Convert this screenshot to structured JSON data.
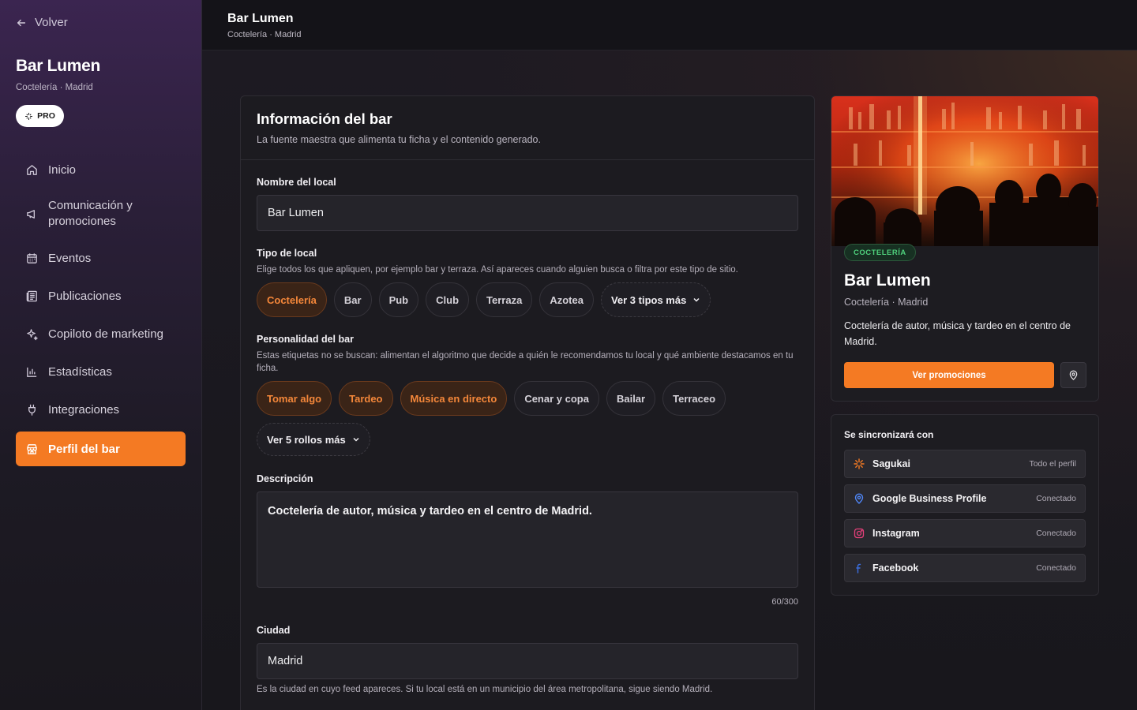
{
  "sidebar": {
    "back_label": "Volver",
    "brand_title": "Bar Lumen",
    "brand_subtitle": "Coctelería · Madrid",
    "plan_badge": "PRO",
    "items": [
      {
        "label": "Inicio",
        "icon": "home-icon"
      },
      {
        "label": "Comunicación y promociones",
        "icon": "megaphone-icon"
      },
      {
        "label": "Eventos",
        "icon": "calendar-icon"
      },
      {
        "label": "Publicaciones",
        "icon": "newspaper-icon"
      },
      {
        "label": "Copiloto de marketing",
        "icon": "sparkles-icon"
      },
      {
        "label": "Estadísticas",
        "icon": "bar-chart-icon"
      },
      {
        "label": "Integraciones",
        "icon": "plug-icon"
      },
      {
        "label": "Perfil del bar",
        "icon": "store-icon",
        "active": true
      }
    ]
  },
  "header": {
    "title": "Bar Lumen",
    "subtitle": "Coctelería · Madrid"
  },
  "form": {
    "title": "Información del bar",
    "subtitle": "La fuente maestra que alimenta tu ficha y el contenido generado.",
    "name": {
      "label": "Nombre del local",
      "value": "Bar Lumen"
    },
    "type": {
      "label": "Tipo de local",
      "help": "Elige todos los que apliquen, por ejemplo bar y terraza. Así apareces cuando alguien busca o filtra por este tipo de sitio.",
      "options": [
        {
          "label": "Coctelería",
          "selected": true
        },
        {
          "label": "Bar",
          "selected": false
        },
        {
          "label": "Pub",
          "selected": false
        },
        {
          "label": "Club",
          "selected": false
        },
        {
          "label": "Terraza",
          "selected": false
        },
        {
          "label": "Azotea",
          "selected": false
        }
      ],
      "more_label": "Ver 3 tipos más"
    },
    "personality": {
      "label": "Personalidad del bar",
      "help": "Estas etiquetas no se buscan: alimentan el algoritmo que decide a quién le recomendamos tu local y qué ambiente destacamos en tu ficha.",
      "options": [
        {
          "label": "Tomar algo",
          "selected": true
        },
        {
          "label": "Tardeo",
          "selected": true
        },
        {
          "label": "Música en directo",
          "selected": true
        },
        {
          "label": "Cenar y copa",
          "selected": false
        },
        {
          "label": "Bailar",
          "selected": false
        },
        {
          "label": "Terraceo",
          "selected": false
        }
      ],
      "more_label": "Ver 5 rollos más"
    },
    "description": {
      "label": "Descripción",
      "value": "Coctelería de autor, música y tardeo en el centro de Madrid.",
      "counter": "60/300"
    },
    "city": {
      "label": "Ciudad",
      "value": "Madrid",
      "help": "Es la ciudad en cuyo feed apareces. Si tu local está en un municipio del área metropolitana, sigue siendo Madrid."
    }
  },
  "preview": {
    "badge": "COCTELERÍA",
    "title": "Bar Lumen",
    "subtitle": "Coctelería · Madrid",
    "description": "Coctelería de autor, música y tardeo en el centro de Madrid.",
    "cta_label": "Ver promociones",
    "pin_icon": "map-pin-icon"
  },
  "sync": {
    "title": "Se sincronizará con",
    "rows": [
      {
        "name": "Sagukai",
        "status": "Todo el perfil",
        "icon": "sparkle-icon",
        "color": "#f47a23"
      },
      {
        "name": "Google Business Profile",
        "status": "Conectado",
        "icon": "google-pin-icon",
        "color": "#4f86f7"
      },
      {
        "name": "Instagram",
        "status": "Conectado",
        "icon": "instagram-icon",
        "color": "#e4407a"
      },
      {
        "name": "Facebook",
        "status": "Conectado",
        "icon": "facebook-icon",
        "color": "#3b6fe0"
      }
    ]
  },
  "colors": {
    "accent": "#f47a23",
    "success": "#4fd07c"
  }
}
